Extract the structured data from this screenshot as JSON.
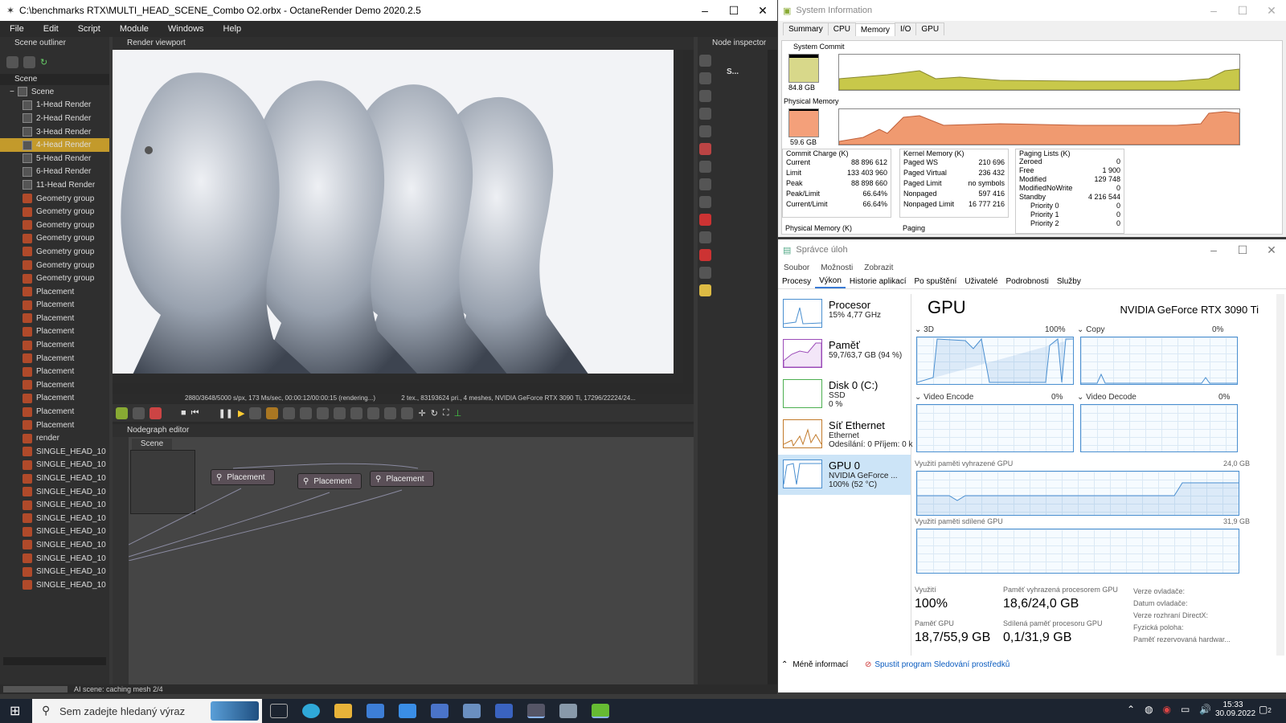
{
  "octane": {
    "title": "C:\\benchmarks RTX\\MULTI_HEAD_SCENE_Combo O2.orbx - OctaneRender Demo 2020.2.5",
    "menu": [
      "File",
      "Edit",
      "Script",
      "Module",
      "Windows",
      "Help"
    ],
    "outliner_title": "Scene outliner",
    "outliner_tab": "Scene",
    "root": "Scene",
    "items": [
      "1-Head Render",
      "2-Head Render",
      "3-Head Render",
      "4-Head Render",
      "5-Head Render",
      "6-Head Render",
      "11-Head Render",
      "Geometry group",
      "Geometry group",
      "Geometry group",
      "Geometry group",
      "Geometry group",
      "Geometry group",
      "Geometry group",
      "Placement",
      "Placement",
      "Placement",
      "Placement",
      "Placement",
      "Placement",
      "Placement",
      "Placement",
      "Placement",
      "Placement",
      "Placement",
      "render",
      "SINGLE_HEAD_10",
      "SINGLE_HEAD_10",
      "SINGLE_HEAD_10",
      "SINGLE_HEAD_10",
      "SINGLE_HEAD_10",
      "SINGLE_HEAD_10",
      "SINGLE_HEAD_10",
      "SINGLE_HEAD_10",
      "SINGLE_HEAD_10",
      "SINGLE_HEAD_10",
      "SINGLE_HEAD_10"
    ],
    "selected_index": 3,
    "viewport_title": "Render viewport",
    "render_status": "2880/3648/5000 s/px, 173 Ms/sec, 00:00:12/00:00:15 (rendering...)",
    "render_stats": "2 tex., 83193624 pri., 4 meshes, NVIDIA GeForce RTX 3090 Ti, 17296/22224/24...",
    "nodegraph_title": "Nodegraph editor",
    "nodegraph_tab": "Scene",
    "nodes": [
      "Placement",
      "Placement",
      "Placement"
    ],
    "inspector_title": "Node inspector",
    "inspector_label": "S...",
    "status": "AI scene: caching mesh 2/4"
  },
  "sysinfo": {
    "title": "System Information",
    "tabs": [
      "Summary",
      "CPU",
      "Memory",
      "I/O",
      "GPU"
    ],
    "active_tab": "Memory",
    "system_commit_label": "System Commit",
    "system_commit_value": "84.8 GB",
    "physical_memory_label": "Physical Memory",
    "physical_memory_value": "59.6 GB",
    "commit_charge": {
      "title": "Commit Charge (K)",
      "rows": [
        [
          "Current",
          "88 896 612"
        ],
        [
          "Limit",
          "133 403 960"
        ],
        [
          "Peak",
          "88 898 660"
        ],
        [
          "Peak/Limit",
          "66.64%"
        ],
        [
          "Current/Limit",
          "66.64%"
        ]
      ]
    },
    "kernel_memory": {
      "title": "Kernel Memory (K)",
      "rows": [
        [
          "Paged WS",
          "210 696"
        ],
        [
          "Paged Virtual",
          "236 432"
        ],
        [
          "Paged Limit",
          "no symbols"
        ],
        [
          "Nonpaged",
          "597 416"
        ],
        [
          "Nonpaged Limit",
          "16 777 216"
        ]
      ]
    },
    "paging_lists": {
      "title": "Paging Lists (K)",
      "rows": [
        [
          "Zeroed",
          "0"
        ],
        [
          "Free",
          "1 900"
        ],
        [
          "Modified",
          "129 748"
        ],
        [
          "ModifiedNoWrite",
          "0"
        ],
        [
          "Standby",
          "4 216 544"
        ],
        [
          "Priority 0",
          "0"
        ],
        [
          "Priority 1",
          "0"
        ],
        [
          "Priority 2",
          "0"
        ]
      ]
    },
    "physical_memory_k": "Physical Memory (K)",
    "paging": "Paging"
  },
  "taskmgr": {
    "title": "Správce úloh",
    "menu": [
      "Soubor",
      "Možnosti",
      "Zobrazit"
    ],
    "tabs": [
      "Procesy",
      "Výkon",
      "Historie aplikací",
      "Po spuštění",
      "Uživatelé",
      "Podrobnosti",
      "Služby"
    ],
    "active_tab": "Výkon",
    "left": [
      {
        "title": "Procesor",
        "l1": "15% 4,77 GHz",
        "l2": ""
      },
      {
        "title": "Paměť",
        "l1": "59,7/63,7 GB (94 %)",
        "l2": ""
      },
      {
        "title": "Disk 0 (C:)",
        "l1": "SSD",
        "l2": "0 %"
      },
      {
        "title": "Síť Ethernet",
        "l1": "Ethernet",
        "l2": "Odesílání: 0 Příjem: 0 k"
      },
      {
        "title": "GPU 0",
        "l1": "NVIDIA GeForce ...",
        "l2": "100% (52 °C)"
      }
    ],
    "gpu_header": "GPU",
    "gpu_name": "NVIDIA GeForce RTX 3090 Ti",
    "engines": [
      {
        "name": "3D",
        "pct": "100%"
      },
      {
        "name": "Copy",
        "pct": "0%"
      },
      {
        "name": "Video Encode",
        "pct": "0%"
      },
      {
        "name": "Video Decode",
        "pct": "0%"
      }
    ],
    "dedicated_label": "Využití paměti vyhrazené GPU",
    "dedicated_max": "24,0 GB",
    "shared_label": "Využití paměti sdílené GPU",
    "shared_max": "31,9 GB",
    "stats": [
      {
        "label": "Využití",
        "value": "100%"
      },
      {
        "label": "Paměť vyhrazená procesorem GPU",
        "value": "18,6/24,0 GB"
      },
      {
        "label": "Paměť GPU",
        "value": "18,7/55,9 GB"
      },
      {
        "label": "Sdílená paměť procesoru GPU",
        "value": "0,1/31,9 GB"
      }
    ],
    "driver": [
      "Verze ovladače:",
      "Datum ovladače:",
      "Verze rozhraní DirectX:",
      "Fyzická poloha:",
      "Paměť rezervovaná hardwar..."
    ],
    "less_info": "Méně informací",
    "monitor_link": "Spustit program Sledování prostředků"
  },
  "taskbar": {
    "search": "Sem zadejte hledaný výraz",
    "time": "15:33",
    "date": "30.09.2022",
    "badge": "2"
  }
}
